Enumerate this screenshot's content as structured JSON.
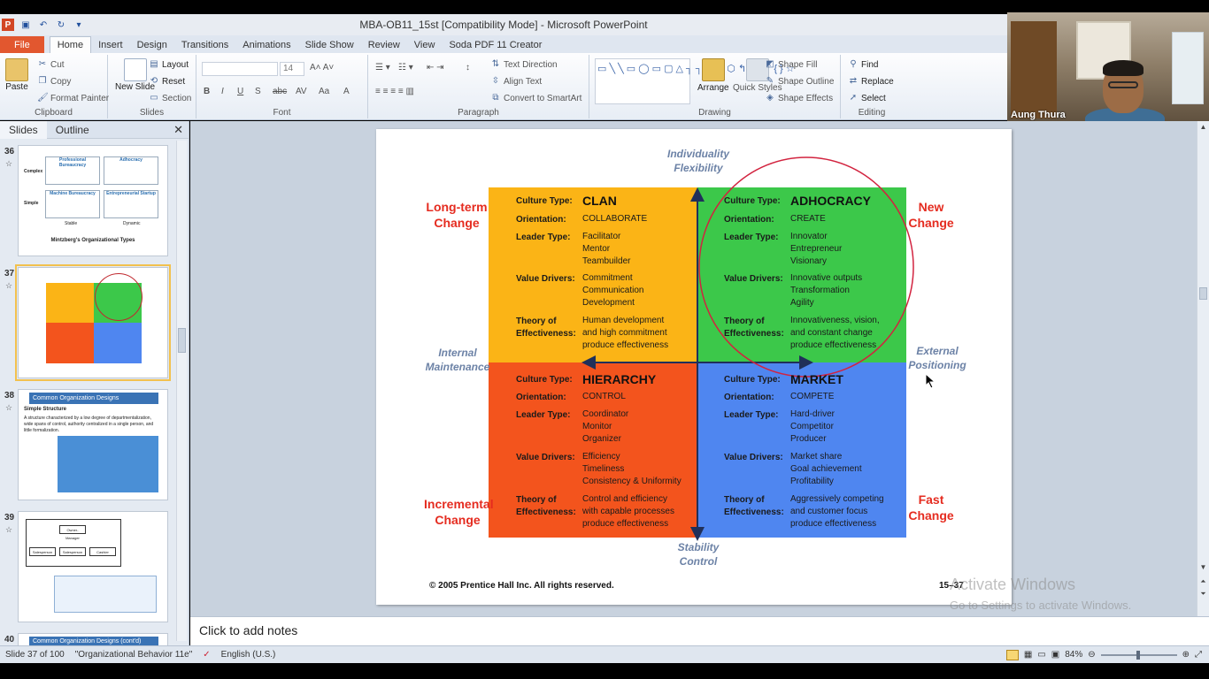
{
  "window": {
    "title": "MBA-OB11_15st [Compatibility Mode]  -  Microsoft PowerPoint",
    "app_logo": "P"
  },
  "ribbon_tabs": [
    "File",
    "Home",
    "Insert",
    "Design",
    "Transitions",
    "Animations",
    "Slide Show",
    "Review",
    "View",
    "Soda PDF 11 Creator"
  ],
  "ribbon": {
    "clipboard": {
      "label": "Clipboard",
      "paste": "Paste",
      "cut": "Cut",
      "copy": "Copy",
      "format_painter": "Format Painter"
    },
    "slides": {
      "label": "Slides",
      "new_slide": "New Slide",
      "layout": "Layout",
      "reset": "Reset",
      "section": "Section"
    },
    "font": {
      "label": "Font",
      "size": "14"
    },
    "paragraph": {
      "label": "Paragraph",
      "text_direction": "Text Direction",
      "align_text": "Align Text",
      "convert_smartart": "Convert to SmartArt"
    },
    "drawing": {
      "label": "Drawing",
      "arrange": "Arrange",
      "quick_styles": "Quick Styles",
      "shape_fill": "Shape Fill",
      "shape_outline": "Shape Outline",
      "shape_effects": "Shape Effects"
    },
    "editing": {
      "label": "Editing",
      "find": "Find",
      "replace": "Replace",
      "select": "Select"
    }
  },
  "webcam": {
    "name": "Aung Thura"
  },
  "panel": {
    "tabs": [
      "Slides",
      "Outline"
    ],
    "close": "✕",
    "thumbs": [
      {
        "num": "36",
        "title": "Mintzberg's Organizational Types",
        "cells": [
          "Professional Bureaucracy",
          "Adhocracy",
          "Machine Bureaucracy",
          "Entrepreneurial Startup"
        ],
        "rows": [
          "Complex",
          "Simple"
        ],
        "cols": [
          "Stable",
          "Dynamic"
        ]
      },
      {
        "num": "37"
      },
      {
        "num": "38",
        "title": "Common Organization Designs",
        "subtitle": "Simple Structure",
        "text": "A structure characterized by a low degree of departmentalization, wide spans of control, authority centralized in a single person, and little formalization."
      },
      {
        "num": "39",
        "boxes": [
          "Owner-Manager",
          "Salesperson",
          "Salesperson",
          "Cashier"
        ]
      },
      {
        "num": "40",
        "title": "Common Organization Designs (cont'd)"
      }
    ]
  },
  "slide": {
    "axes": {
      "top": [
        "Individuality",
        "Flexibility"
      ],
      "bottom": [
        "Stability",
        "Control"
      ],
      "left": [
        "Internal",
        "Maintenance"
      ],
      "right": [
        "External",
        "Positioning"
      ]
    },
    "corners": {
      "top_left": [
        "Long-term",
        "Change"
      ],
      "top_right": [
        "New",
        "Change"
      ],
      "bottom_left": [
        "Incremental",
        "Change"
      ],
      "bottom_right": [
        "Fast",
        "Change"
      ]
    },
    "labels": {
      "culture_type": "Culture Type:",
      "orientation": "Orientation:",
      "leader_type": "Leader Type:",
      "value_drivers": "Value Drivers:",
      "theory": [
        "Theory of",
        "Effectiveness:"
      ]
    },
    "quadrants": [
      {
        "id": "clan",
        "name": "CLAN",
        "orientation": "COLLABORATE",
        "leaders": [
          "Facilitator",
          "Mentor",
          "Teambuilder"
        ],
        "drivers": [
          "Commitment",
          "Communication",
          "Development"
        ],
        "theory": [
          "Human development",
          "and high commitment",
          "produce effectiveness"
        ],
        "color": "#fbb416"
      },
      {
        "id": "adhocracy",
        "name": "ADHOCRACY",
        "orientation": "CREATE",
        "leaders": [
          "Innovator",
          "Entrepreneur",
          "Visionary"
        ],
        "drivers": [
          "Innovative outputs",
          "Transformation",
          "Agility"
        ],
        "theory": [
          "Innovativeness, vision,",
          "and constant change",
          "produce effectiveness"
        ],
        "color": "#3cc84a"
      },
      {
        "id": "hierarchy",
        "name": "HIERARCHY",
        "orientation": "CONTROL",
        "leaders": [
          "Coordinator",
          "Monitor",
          "Organizer"
        ],
        "drivers": [
          "Efficiency",
          "Timeliness",
          "Consistency & Uniformity"
        ],
        "theory": [
          "Control and efficiency",
          "with capable processes",
          "produce effectiveness"
        ],
        "color": "#f3541d"
      },
      {
        "id": "market",
        "name": "MARKET",
        "orientation": "COMPETE",
        "leaders": [
          "Hard-driver",
          "Competitor",
          "Producer"
        ],
        "drivers": [
          "Market share",
          "Goal achievement",
          "Profitability"
        ],
        "theory": [
          "Aggressively competing",
          "and customer focus",
          "produce effectiveness"
        ],
        "color": "#4f86f0"
      }
    ],
    "copyright": "© 2005 Prentice Hall Inc. All rights reserved.",
    "page": "15–37"
  },
  "notes": {
    "placeholder": "Click to add notes"
  },
  "status": {
    "slide": "Slide 37 of 100",
    "theme": "\"Organizational Behavior 11e\"",
    "language": "English (U.S.)",
    "zoom": "84%"
  },
  "watermark": {
    "line1": "Activate Windows",
    "line2": "Go to Settings to activate Windows."
  },
  "colors": {
    "accent_red": "#e52c20",
    "axis_text": "#6c82a6",
    "file_tab": "#e2572f"
  }
}
